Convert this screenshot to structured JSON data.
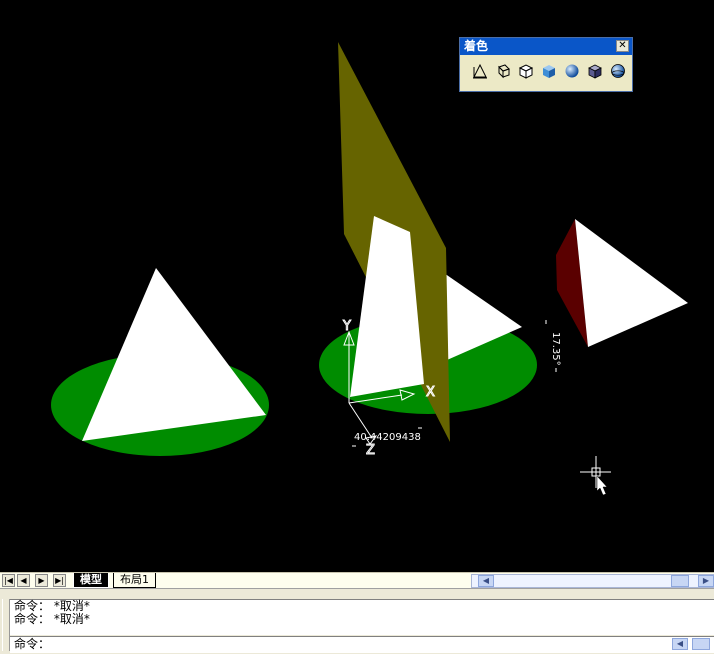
{
  "toolbar": {
    "title": "着色",
    "close": "✕",
    "buttons": [
      {
        "name": "2d-wireframe-icon"
      },
      {
        "name": "3d-wireframe-icon"
      },
      {
        "name": "hidden-icon"
      },
      {
        "name": "flat-shaded-icon"
      },
      {
        "name": "gouraud-shaded-icon"
      },
      {
        "name": "flat-shaded-edges-on-icon"
      },
      {
        "name": "gouraud-shaded-edges-on-icon"
      }
    ]
  },
  "viewport": {
    "dimension_value": "40.44209438",
    "angle_value": "17.35°",
    "ucs_x_label": "X",
    "ucs_y_label": "Y",
    "ucs_z_label": "Z"
  },
  "tabs": {
    "model": "模型",
    "layout1": "布局1"
  },
  "command": {
    "history": [
      "命令：  *取消*",
      "命令：  *取消*"
    ],
    "prompt": "命令："
  }
}
